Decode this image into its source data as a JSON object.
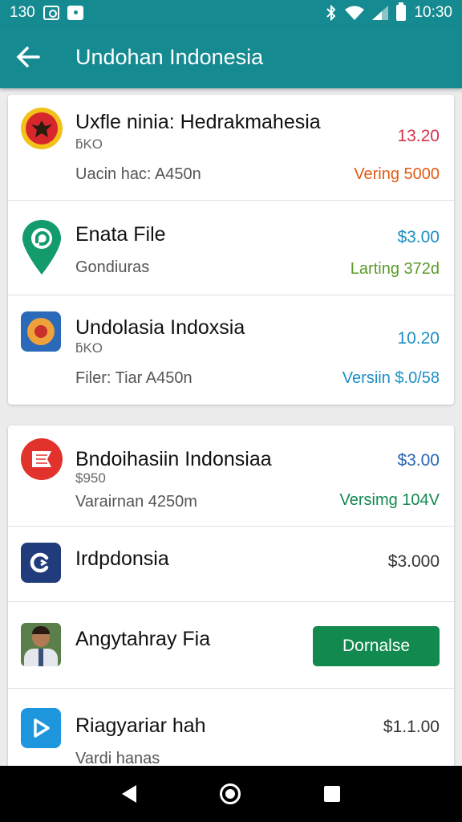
{
  "status_bar": {
    "time_left": "130",
    "time_right": "10:30"
  },
  "header": {
    "title": "Undohan Indonesia"
  },
  "card1": [
    {
      "title": "Uxfle ninia: Hedrakmahesia",
      "sub1": "ƃKO",
      "sub2": "Uacin hac: A450n",
      "price": "13.20",
      "meta": "Vering 5000",
      "price_color": "#d6334b",
      "meta_color": "#e35a12",
      "icon": "garuda-emblem-icon"
    },
    {
      "title": "Enata File",
      "sub2": "Gondiuras",
      "price": "$3.00",
      "meta": "Larting 372d",
      "price_color": "#1b8fc5",
      "meta_color": "#5b9a2a",
      "icon": "map-pin-chat-icon"
    },
    {
      "title": "Undolasia Indoxsia",
      "sub1": "ƃKO",
      "sub2": "Filer: Tiar A450n",
      "price": "10.20",
      "meta": "Versiin $.0/58",
      "price_color": "#1b8fc5",
      "meta_color": "#1b8fc5",
      "icon": "emblem-app-icon"
    }
  ],
  "card2": [
    {
      "title": "Bndoihasiin Indonsiaa",
      "sub1": "$950",
      "sub2": "Varairnan 4250m",
      "price": "$3.00",
      "meta": "Versimg 104V",
      "price_color": "#2a64b5",
      "meta_color": "#12894f",
      "icon": "flag-icon"
    },
    {
      "title": "Irdpdonsia",
      "price": "$3.000",
      "price_color": "#333333",
      "icon": "refresh-app-icon"
    },
    {
      "title": "Angytahray Fia",
      "button": "Dornalse",
      "icon": "person-avatar-icon"
    },
    {
      "title": "Riagyariar hah",
      "sub2": "Vardi hanas",
      "price": "$1.1.00",
      "price_color": "#333333",
      "icon": "play-icon"
    }
  ],
  "colors": {
    "primary": "#168a91",
    "button_green": "#12894f"
  }
}
